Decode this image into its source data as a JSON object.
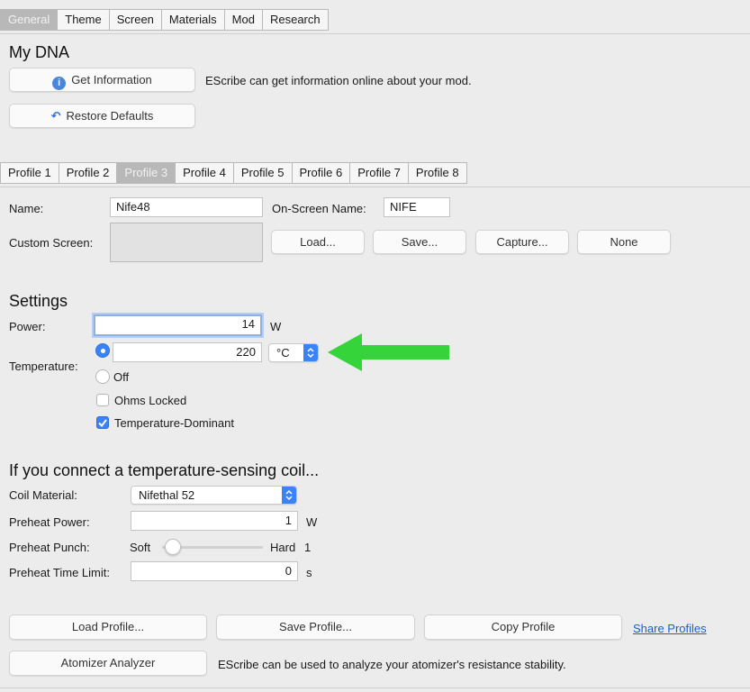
{
  "top_tabs": [
    "General",
    "Theme",
    "Screen",
    "Materials",
    "Mod",
    "Research"
  ],
  "top_tabs_active": "General",
  "my_dna": {
    "title": "My DNA",
    "get_info_label": "Get Information",
    "get_info_desc": "EScribe can get information online about your mod.",
    "restore_label": "Restore Defaults"
  },
  "profile_tabs": [
    "Profile 1",
    "Profile 2",
    "Profile 3",
    "Profile 4",
    "Profile 5",
    "Profile 6",
    "Profile 7",
    "Profile 8"
  ],
  "profile_tabs_active": "Profile 3",
  "profile": {
    "name_label": "Name:",
    "name_value": "Nife48",
    "onscreen_label": "On-Screen Name:",
    "onscreen_value": "NIFE",
    "custom_screen_label": "Custom Screen:",
    "load_label": "Load...",
    "save_label": "Save...",
    "capture_label": "Capture...",
    "none_label": "None"
  },
  "settings": {
    "title": "Settings",
    "power_label": "Power:",
    "power_value": "14",
    "power_unit": "W",
    "temperature_label": "Temperature:",
    "temperature_value": "220",
    "temperature_unit": "°C",
    "off_label": "Off",
    "ohms_locked_label": "Ohms Locked",
    "ohms_locked": false,
    "temp_dominant_label": "Temperature-Dominant",
    "temp_dominant": true
  },
  "coil": {
    "title": "If you connect a temperature-sensing coil...",
    "material_label": "Coil Material:",
    "material_value": "Nifethal 52",
    "preheat_power_label": "Preheat Power:",
    "preheat_power_value": "1",
    "preheat_power_unit": "W",
    "preheat_punch_label": "Preheat Punch:",
    "punch_soft": "Soft",
    "punch_hard": "Hard",
    "punch_value": "1",
    "preheat_time_label": "Preheat Time Limit:",
    "preheat_time_value": "0",
    "preheat_time_unit": "s"
  },
  "bottom": {
    "load_profile_label": "Load Profile...",
    "save_profile_label": "Save Profile...",
    "copy_profile_label": "Copy Profile",
    "share_profiles_label": "Share Profiles",
    "atomizer_label": "Atomizer Analyzer",
    "atomizer_desc": "EScribe can be used to analyze your atomizer's resistance stability."
  },
  "colors": {
    "accent": "#3a82f7",
    "arrow": "#34d43a",
    "link": "#1f5bd6"
  }
}
